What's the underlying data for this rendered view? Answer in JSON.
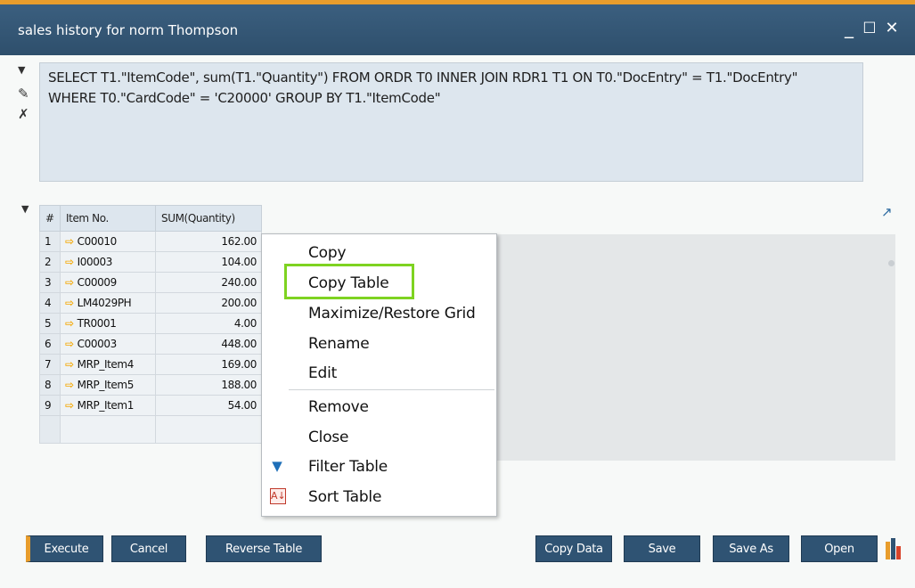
{
  "window": {
    "title": "sales history for norm Thompson",
    "minimize": "_",
    "maximize": "☐",
    "close": "✕"
  },
  "query": {
    "line1": "SELECT T1.\"ItemCode\", sum(T1.\"Quantity\") FROM ORDR T0  INNER JOIN RDR1 T1 ON T0.\"DocEntry\" = T1.\"DocEntry\"",
    "line2": "WHERE T0.\"CardCode\"  = 'C20000' GROUP BY T1.\"ItemCode\""
  },
  "grid": {
    "columns": [
      "#",
      "Item No.",
      "SUM(Quantity)"
    ],
    "rows": [
      {
        "num": "1",
        "item": "C00010",
        "qty": "162.00"
      },
      {
        "num": "2",
        "item": "I00003",
        "qty": "104.00"
      },
      {
        "num": "3",
        "item": "C00009",
        "qty": "240.00"
      },
      {
        "num": "4",
        "item": "LM4029PH",
        "qty": "200.00"
      },
      {
        "num": "5",
        "item": "TR0001",
        "qty": "4.00"
      },
      {
        "num": "6",
        "item": "C00003",
        "qty": "448.00"
      },
      {
        "num": "7",
        "item": "MRP_Item4",
        "qty": "169.00"
      },
      {
        "num": "8",
        "item": "MRP_Item5",
        "qty": "188.00"
      },
      {
        "num": "9",
        "item": "MRP_Item1",
        "qty": "54.00"
      }
    ]
  },
  "context_menu": {
    "items": [
      "Copy",
      "Copy Table",
      "Maximize/Restore Grid",
      "Rename",
      "Edit",
      "Remove",
      "Close",
      "Filter Table",
      "Sort Table"
    ],
    "highlighted": "Copy Table",
    "highlight_color": "#7ed321"
  },
  "buttons": {
    "execute": "Execute",
    "cancel": "Cancel",
    "reverse_table": "Reverse Table",
    "copy_data": "Copy Data",
    "save": "Save",
    "save_as": "Save As",
    "open": "Open"
  },
  "icons": {
    "query_toggle": "triangle-down-icon",
    "edit": "pencil-icon",
    "clear": "eraser-icon",
    "grid_toggle": "triangle-down-icon",
    "row_link": "link-arrow-icon",
    "filter": "filter-icon",
    "sort": "sort-icon",
    "pin": "pin-icon",
    "chart": "bar-chart-icon"
  },
  "colors": {
    "titlebar": "#34577a",
    "accent": "#e89d2c",
    "button": "#2f5373",
    "query_bg": "#dde6ee"
  }
}
